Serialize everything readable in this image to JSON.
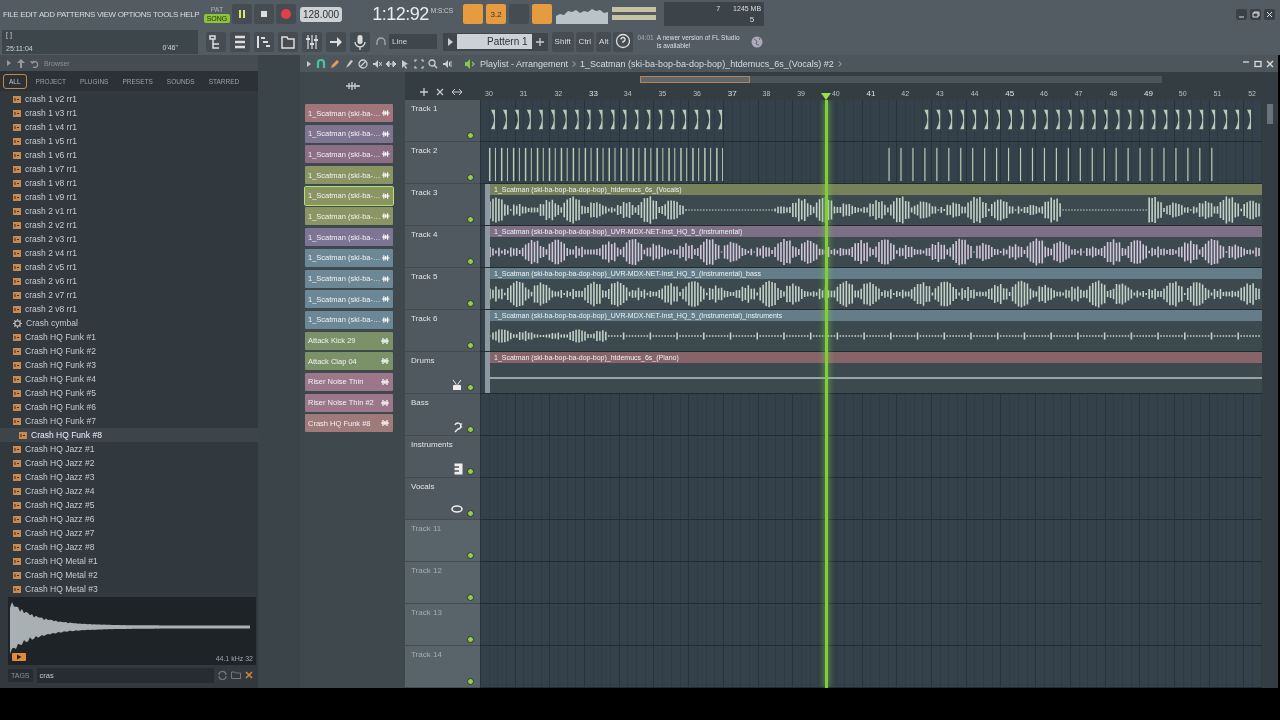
{
  "menu": [
    "FILE",
    "EDIT",
    "ADD",
    "PATTERNS",
    "VIEW",
    "OPTIONS",
    "TOOLS",
    "HELP"
  ],
  "hint_panel": {
    "bracket": "[ ]",
    "time": "25:11:04",
    "duration": "0'46\""
  },
  "transport": {
    "modes": [
      {
        "label": "PAT",
        "selected": false
      },
      {
        "label": "SONG",
        "selected": true
      }
    ],
    "playing": true,
    "tempo": "128.000",
    "time": "1:12:92",
    "time_unit": "M:S:CS"
  },
  "shortcuts": [
    {
      "selected": true
    },
    {
      "label": "3.2",
      "selected": true
    },
    {
      "selected": false
    },
    {
      "selected": true
    }
  ],
  "monitor": {
    "cpu": "7",
    "memory": "1245 MB",
    "polyphony": "5"
  },
  "snap": "Line",
  "pattern": "Pattern 1",
  "modifiers": [
    "Shift",
    "Ctrl",
    "Alt"
  ],
  "news": {
    "time": "04:01",
    "text": "A newer version of FL Studio is available!"
  },
  "browser": {
    "title": "Browser",
    "tabs": [
      {
        "label": "ALL",
        "selected": true
      },
      {
        "label": "PROJECT",
        "selected": false
      },
      {
        "label": "PLUGINS",
        "selected": false
      },
      {
        "label": "PRESETS",
        "selected": false
      },
      {
        "label": "SOUNDS",
        "selected": false
      },
      {
        "label": "STARRED",
        "selected": false
      }
    ],
    "items": [
      {
        "label": "crash 1 v2 rr1",
        "kind": "sample",
        "selected": false
      },
      {
        "label": "crash 1 v3 rr1",
        "kind": "sample",
        "selected": false
      },
      {
        "label": "crash 1 v4 rr1",
        "kind": "sample",
        "selected": false
      },
      {
        "label": "crash 1 v5 rr1",
        "kind": "sample",
        "selected": false
      },
      {
        "label": "crash 1 v6 rr1",
        "kind": "sample",
        "selected": false
      },
      {
        "label": "crash 1 v7 rr1",
        "kind": "sample",
        "selected": false
      },
      {
        "label": "crash 1 v8 rr1",
        "kind": "sample",
        "selected": false
      },
      {
        "label": "crash 1 v9 rr1",
        "kind": "sample",
        "selected": false
      },
      {
        "label": "crash 2 v1 rr1",
        "kind": "sample",
        "selected": false
      },
      {
        "label": "crash 2 v2 rr1",
        "kind": "sample",
        "selected": false
      },
      {
        "label": "crash 2 v3 rr1",
        "kind": "sample",
        "selected": false
      },
      {
        "label": "crash 2 v4 rr1",
        "kind": "sample",
        "selected": false
      },
      {
        "label": "crash 2 v5 rr1",
        "kind": "sample",
        "selected": false
      },
      {
        "label": "crash 2 v6 rr1",
        "kind": "sample",
        "selected": false
      },
      {
        "label": "crash 2 v7 rr1",
        "kind": "sample",
        "selected": false
      },
      {
        "label": "crash 2 v8 rr1",
        "kind": "sample",
        "selected": false
      },
      {
        "label": "Crash cymbal",
        "kind": "preset",
        "selected": false
      },
      {
        "label": "Crash HQ Funk #1",
        "kind": "sample",
        "selected": false
      },
      {
        "label": "Crash HQ Funk #2",
        "kind": "sample",
        "selected": false
      },
      {
        "label": "Crash HQ Funk #3",
        "kind": "sample",
        "selected": false
      },
      {
        "label": "Crash HQ Funk #4",
        "kind": "sample",
        "selected": false
      },
      {
        "label": "Crash HQ Funk #5",
        "kind": "sample",
        "selected": false
      },
      {
        "label": "Crash HQ Funk #6",
        "kind": "sample",
        "selected": false
      },
      {
        "label": "Crash HQ Funk #7",
        "kind": "sample",
        "selected": false
      },
      {
        "label": "Crash HQ Funk #8",
        "kind": "sample",
        "selected": true
      },
      {
        "label": "Crash HQ Jazz #1",
        "kind": "sample",
        "selected": false
      },
      {
        "label": "Crash HQ Jazz #2",
        "kind": "sample",
        "selected": false
      },
      {
        "label": "Crash HQ Jazz #3",
        "kind": "sample",
        "selected": false
      },
      {
        "label": "Crash HQ Jazz #4",
        "kind": "sample",
        "selected": false
      },
      {
        "label": "Crash HQ Jazz #5",
        "kind": "sample",
        "selected": false
      },
      {
        "label": "Crash HQ Jazz #6",
        "kind": "sample",
        "selected": false
      },
      {
        "label": "Crash HQ Jazz #7",
        "kind": "sample",
        "selected": false
      },
      {
        "label": "Crash HQ Jazz #8",
        "kind": "sample",
        "selected": false
      },
      {
        "label": "Crash HQ Metal #1",
        "kind": "sample",
        "selected": false
      },
      {
        "label": "Crash HQ Metal #2",
        "kind": "sample",
        "selected": false
      },
      {
        "label": "Crash HQ Metal #3",
        "kind": "sample",
        "selected": false
      }
    ],
    "preview_info": "44.1 kHz 32",
    "tags_label": "TAGS",
    "search": "cras"
  },
  "playlist": {
    "title": "Playlist - Arrangement",
    "breadcrumb": "1_Scatman (ski-ba-bop-ba-dop-bop)_htdemucs_6s_(Vocals) #2",
    "channels": [
      {
        "label": "1_Scatman (ski-ba-…",
        "color": "#a0757c",
        "selected": false
      },
      {
        "label": "1_Scatman (ski-ba-…",
        "color": "#7f7590",
        "selected": false
      },
      {
        "label": "1_Scatman (ski-ba-…",
        "color": "#8c6f86",
        "selected": false
      },
      {
        "label": "1_Scatman (ski-ba-…",
        "color": "#8a9563",
        "selected": false
      },
      {
        "label": "1_Scatman (ski-ba-…",
        "color": "#8a9563",
        "selected": true
      },
      {
        "label": "1_Scatman (ski-ba-…",
        "color": "#8a9563",
        "selected": false
      },
      {
        "label": "1_Scatman (ski-ba-…",
        "color": "#7d7593",
        "selected": false
      },
      {
        "label": "1_Scatman (ski-ba-…",
        "color": "#6c8795",
        "selected": false
      },
      {
        "label": "1_Scatman (ski-ba-…",
        "color": "#6c8795",
        "selected": false
      },
      {
        "label": "1_Scatman (ski-ba-…",
        "color": "#6c8795",
        "selected": false
      },
      {
        "label": "1_Scatman (ski-ba-…",
        "color": "#6c8795",
        "selected": false
      },
      {
        "label": "Attack Kick 29",
        "color": "#7b9168",
        "selected": false
      },
      {
        "label": "Attack Clap 04",
        "color": "#7b9168",
        "selected": false
      },
      {
        "label": "Riser Noise Thin",
        "color": "#9c7789",
        "selected": false
      },
      {
        "label": "Riser Noise Thin #2",
        "color": "#9c7789",
        "selected": false
      },
      {
        "label": "Crash HQ Funk #8",
        "color": "#a07a7a",
        "selected": false
      }
    ],
    "ruler": [
      "30",
      "31",
      "32",
      "33",
      "34",
      "35",
      "36",
      "37",
      "38",
      "39",
      "40",
      "41",
      "42",
      "43",
      "44",
      "45",
      "46",
      "47",
      "48",
      "49",
      "50",
      "51",
      "52"
    ],
    "playhead": {
      "level": 0.443
    },
    "tracks": [
      {
        "label": "Track 1",
        "kind": "plain",
        "disabled": false,
        "enabled": true,
        "clip": {
          "kind": "beats",
          "color": "#b9cbb5"
        }
      },
      {
        "label": "Track 2",
        "kind": "plain",
        "disabled": false,
        "enabled": true,
        "clip": {
          "kind": "ticks",
          "color": "#b9cbb5"
        }
      },
      {
        "label": "Track 3",
        "kind": "plain",
        "disabled": false,
        "enabled": true,
        "clip": {
          "kind": "audio",
          "title": "1_Scatman (ski-ba-bop-ba-dop-bop)_htdemucs_6s_(Vocals)",
          "color": "#77825a"
        }
      },
      {
        "label": "Track 4",
        "kind": "plain",
        "disabled": false,
        "enabled": true,
        "clip": {
          "kind": "audio",
          "title": "1_Scatman (ski-ba-bop-ba-dop-bop)_UVR-MDX-NET-Inst_HQ_5_(Instrumental)",
          "color": "#7d6f85"
        }
      },
      {
        "label": "Track 5",
        "kind": "plain",
        "disabled": false,
        "enabled": true,
        "clip": {
          "kind": "audio",
          "title": "1_Scatman (ski-ba-bop-ba-dop-bop)_UVR-MDX-NET-Inst_HQ_5_(Instrumental)_bass",
          "color": "#647d89"
        }
      },
      {
        "label": "Track 6",
        "kind": "plain",
        "disabled": false,
        "enabled": true,
        "clip": {
          "kind": "audio_quiet",
          "title": "1_Scatman (ski-ba-bop-ba-dop-bop)_UVR-MDX-NET-Inst_HQ_5_(Instrumental)_instruments",
          "color": "#647d89"
        }
      },
      {
        "label": "Drums",
        "kind": "drums",
        "disabled": false,
        "enabled": true,
        "clip": {
          "kind": "audio_flat",
          "title": "1_Scatman (ski-ba-bop-ba-dop-bop)_htdemucs_6s_(Piano)",
          "color": "#86646a"
        }
      },
      {
        "label": "Bass",
        "kind": "bass",
        "disabled": false,
        "enabled": true
      },
      {
        "label": "Instruments",
        "kind": "instruments",
        "disabled": false,
        "enabled": true
      },
      {
        "label": "Vocals",
        "kind": "vocals",
        "disabled": false,
        "enabled": true
      },
      {
        "label": "Track 11",
        "kind": "plain",
        "disabled": true,
        "enabled": true
      },
      {
        "label": "Track 12",
        "kind": "plain",
        "disabled": true,
        "enabled": true
      },
      {
        "label": "Track 13",
        "kind": "plain",
        "disabled": true,
        "enabled": true
      },
      {
        "label": "Track 14",
        "kind": "plain",
        "disabled": true,
        "enabled": true
      }
    ]
  }
}
